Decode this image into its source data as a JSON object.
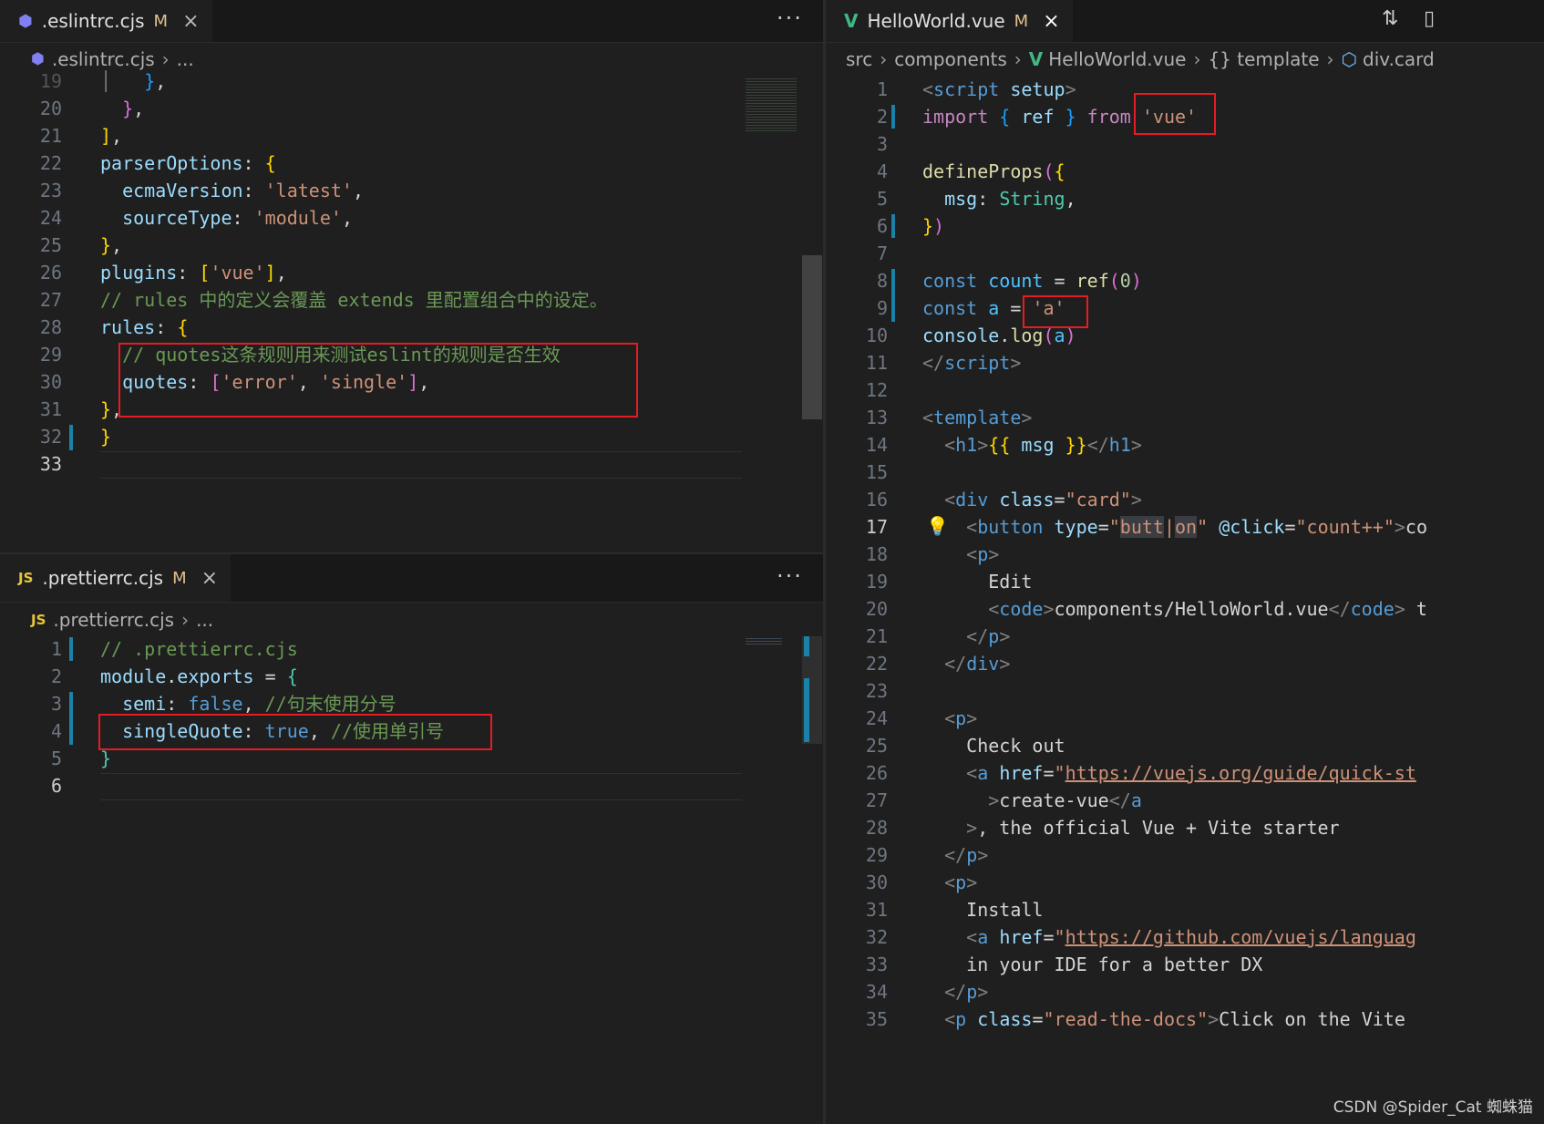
{
  "left_top": {
    "tab": {
      "icon": "eslint-icon",
      "name": ".eslintrc.cjs",
      "modified": "M",
      "close": "×"
    },
    "more": "···",
    "breadcrumb": {
      "file": ".eslintrc.cjs",
      "rest": "..."
    }
  },
  "left_bottom": {
    "tab": {
      "icon_label": "JS",
      "name": ".prettierrc.cjs",
      "modified": "M",
      "close": "×"
    },
    "more": "···",
    "breadcrumb": {
      "icon_label": "JS",
      "file": ".prettierrc.cjs",
      "rest": "..."
    }
  },
  "right": {
    "tab": {
      "icon": "vue-icon",
      "name": "HelloWorld.vue",
      "modified": "M",
      "close": "×"
    },
    "breadcrumb": {
      "src": "src",
      "components": "components",
      "file": "HelloWorld.vue",
      "template": "{} template",
      "div": "div.card"
    }
  },
  "watermark": "CSDN @Spider_Cat 蜘蛛猫",
  "colors": {
    "highlight_box": "#e51c23",
    "editor_bg": "#1f1f1f",
    "keyword": "#569cd6",
    "string": "#ce9178",
    "comment": "#6a9955"
  }
}
